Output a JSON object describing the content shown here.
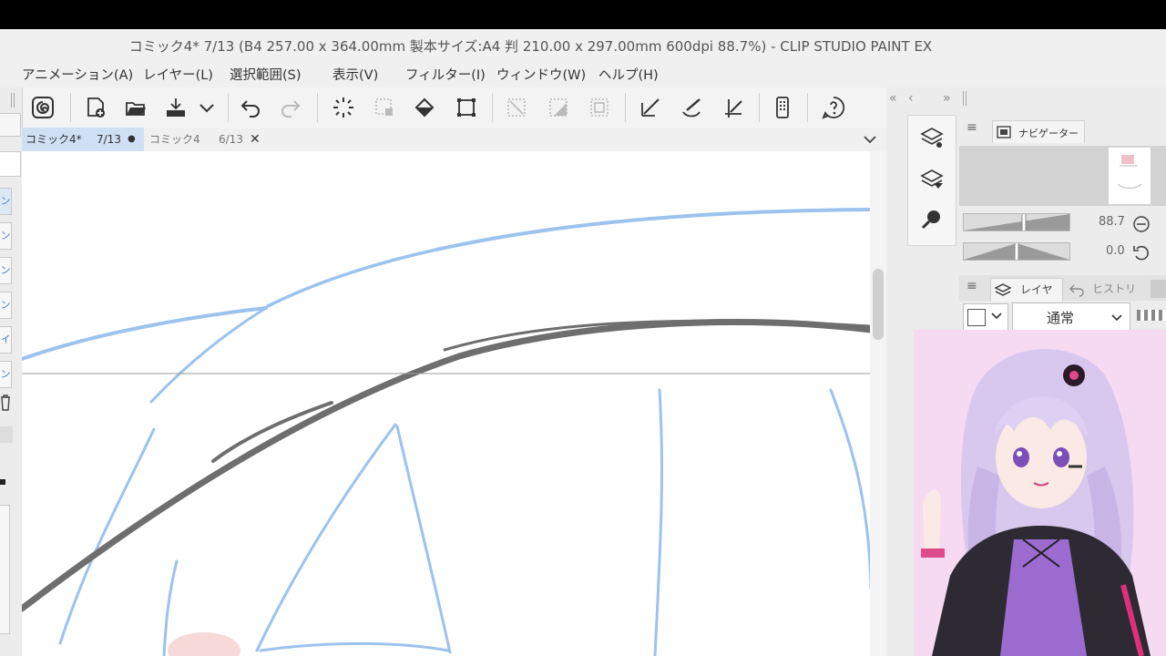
{
  "app": {
    "title": "コミック4* 7/13 (B4 257.00 x 364.00mm 製本サイズ:A4 判 210.00 x 297.00mm 600dpi 88.7%)  - CLIP STUDIO PAINT EX"
  },
  "menu": [
    {
      "label": "アニメーション(A)"
    },
    {
      "label": "レイヤー(L)"
    },
    {
      "label": "選択範囲(S)"
    },
    {
      "label": "表示(V)"
    },
    {
      "label": "フィルター(I)"
    },
    {
      "label": "ウィンドウ(W)"
    },
    {
      "label": "ヘルプ(H)"
    }
  ],
  "toolbar": {
    "icons": [
      "clip-studio-icon",
      "new-file-icon",
      "open-folder-icon",
      "save-icon",
      "dropdown-chevron-icon",
      "undo-icon",
      "redo-icon",
      "loading-spinner-icon",
      "select-stamp-icon",
      "fill-bucket-icon",
      "transform-icon",
      "clear-selection-icon",
      "fill-selection-icon",
      "select-border-icon",
      "pen-ruler-icon",
      "brush-icon",
      "perspective-ruler-icon",
      "device-icon",
      "help-icon"
    ]
  },
  "tabs": [
    {
      "name": "コミック4*",
      "page": "7/13",
      "status": "●",
      "active": true
    },
    {
      "name": "コミック4",
      "page": "6/13",
      "status": "✕",
      "active": false
    }
  ],
  "left_rail": {
    "items": [
      "ン",
      "ン",
      "ン",
      "ン",
      "イ",
      "ン"
    ]
  },
  "navigator": {
    "label": "ナビゲーター",
    "zoom": "88.7",
    "rotation": "0.0",
    "colors": {
      "accent": "#4a7ac0"
    }
  },
  "layers": {
    "tabs": [
      {
        "label": "レイヤー"
      },
      {
        "label": "ヒストリー"
      }
    ],
    "blend_mode": "通常"
  },
  "strokes": {
    "blue": "#9cc2ee",
    "gray": "#6e6e6e"
  }
}
